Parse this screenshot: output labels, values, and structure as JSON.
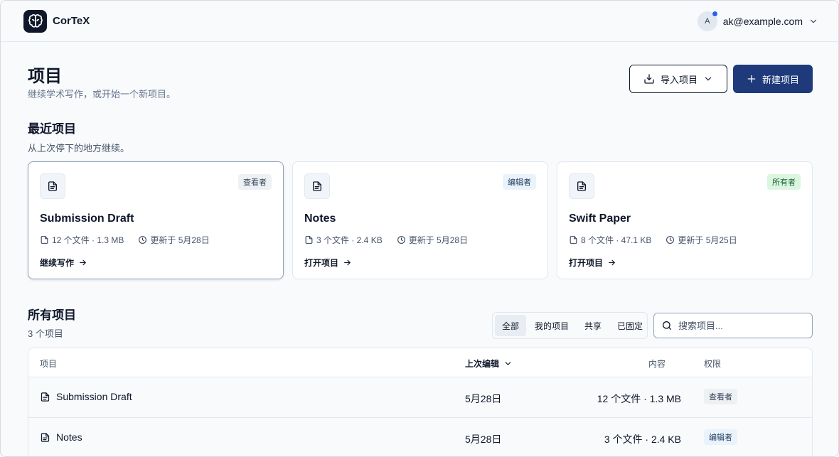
{
  "app": {
    "name": "CorTeX"
  },
  "user": {
    "avatar_initial": "A",
    "email": "ak@example.com"
  },
  "page": {
    "title": "项目",
    "subtitle": "继续学术写作，或开始一个新项目。"
  },
  "actions": {
    "import_label": "导入项目",
    "new_label": "新建项目"
  },
  "recent": {
    "title": "最近项目",
    "subtitle": "从上次停下的地方继续。",
    "cards": [
      {
        "title": "Submission Draft",
        "files": "12 个文件 · 1.3 MB",
        "updated": "更新于 5月28日",
        "role": "查看者",
        "action": "继续写作"
      },
      {
        "title": "Notes",
        "files": "3 个文件 · 2.4 KB",
        "updated": "更新于 5月28日",
        "role": "编辑者",
        "action": "打开项目"
      },
      {
        "title": "Swift Paper",
        "files": "8 个文件 · 47.1 KB",
        "updated": "更新于 5月25日",
        "role": "所有者",
        "action": "打开项目"
      }
    ]
  },
  "all": {
    "title": "所有项目",
    "count": "3 个项目",
    "filters": [
      "全部",
      "我的项目",
      "共享",
      "已固定"
    ],
    "active_filter": "全部",
    "search_placeholder": "搜索项目...",
    "columns": {
      "name": "项目",
      "edited": "上次编辑",
      "content": "内容",
      "permission": "权限"
    },
    "rows": [
      {
        "name": "Submission Draft",
        "date": "5月28日",
        "content": "12 个文件 · 1.3 MB",
        "role": "查看者"
      },
      {
        "name": "Notes",
        "date": "5月28日",
        "content": "3 个文件 · 2.4 KB",
        "role": "编辑者"
      }
    ]
  },
  "colors": {
    "primary": "#1e3a7b",
    "accent_dot": "#2563eb",
    "owner_badge": "#dcf5df",
    "editor_badge": "#eaf3fb",
    "viewer_badge": "#eef1f4"
  }
}
